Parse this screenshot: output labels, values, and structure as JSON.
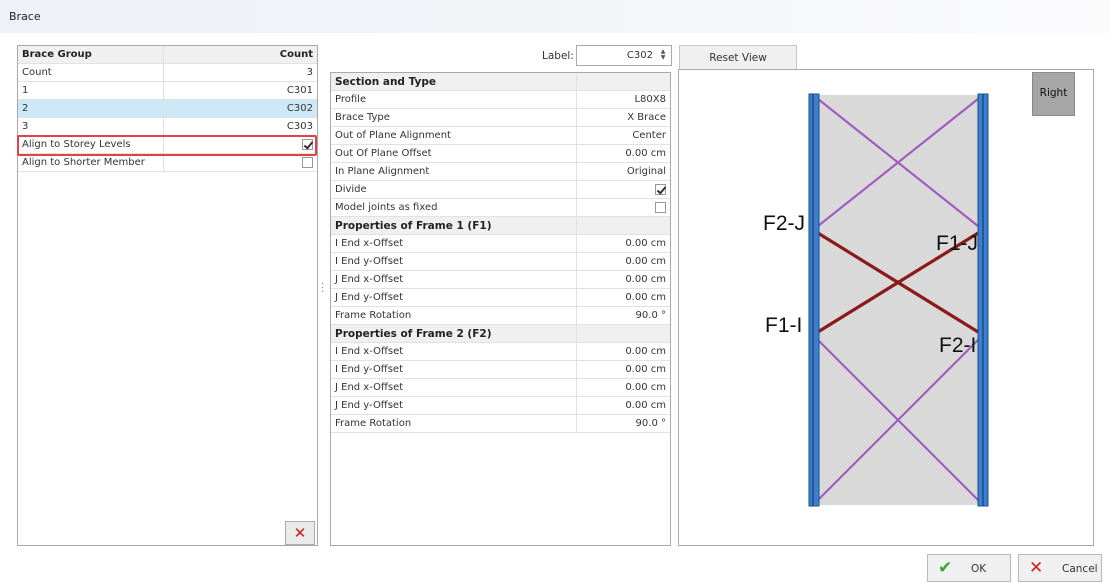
{
  "window": {
    "title": "Brace"
  },
  "brace_group": {
    "header": {
      "name": "Brace Group",
      "value": "Count"
    },
    "rows": [
      {
        "name": "Count",
        "value": "3"
      },
      {
        "name": "1",
        "value": "C301"
      },
      {
        "name": "2",
        "value": "C302",
        "selected": true
      },
      {
        "name": "3",
        "value": "C303"
      }
    ],
    "options": [
      {
        "name": "Align to Storey Levels",
        "checked": true
      },
      {
        "name": "Align to Shorter Member",
        "checked": false
      }
    ],
    "delete_icon": "x-icon"
  },
  "label_field": {
    "label": "Label:",
    "value": "C302"
  },
  "properties": {
    "section1": {
      "title": "Section and Type",
      "rows": [
        {
          "name": "Profile",
          "value": "L80X8"
        },
        {
          "name": "Brace Type",
          "value": "X Brace"
        },
        {
          "name": "Out of Plane Alignment",
          "value": "Center"
        },
        {
          "name": "Out Of Plane Offset",
          "value": "0.00 cm"
        },
        {
          "name": "In Plane Alignment",
          "value": "Original"
        }
      ],
      "checks": [
        {
          "name": "Divide",
          "checked": true
        },
        {
          "name": "Model joints as fixed",
          "checked": false
        }
      ]
    },
    "section2": {
      "title": "Properties of Frame 1 (F1)",
      "rows": [
        {
          "name": "I End x-Offset",
          "value": "0.00 cm"
        },
        {
          "name": "I End y-Offset",
          "value": "0.00 cm"
        },
        {
          "name": "J End x-Offset",
          "value": "0.00 cm"
        },
        {
          "name": "J End y-Offset",
          "value": "0.00 cm"
        },
        {
          "name": "Frame Rotation",
          "value": "90.0 °"
        }
      ]
    },
    "section3": {
      "title": "Properties of Frame 2 (F2)",
      "rows": [
        {
          "name": "I End x-Offset",
          "value": "0.00 cm"
        },
        {
          "name": "I End y-Offset",
          "value": "0.00 cm"
        },
        {
          "name": "J End x-Offset",
          "value": "0.00 cm"
        },
        {
          "name": "J End y-Offset",
          "value": "0.00 cm"
        },
        {
          "name": "Frame Rotation",
          "value": "90.0 °"
        }
      ]
    }
  },
  "viewer": {
    "reset_label": "Reset View",
    "view_label": "Right",
    "frame_labels": {
      "f2j": "F2-J",
      "f1j": "F1-J",
      "f1i": "F1-I",
      "f2i": "F2-I"
    },
    "colors": {
      "column": "#3a7fd0",
      "panel": "#d9d9d9",
      "brace_light": "#a25cbf",
      "brace_dark": "#8b1a1a"
    }
  },
  "buttons": {
    "ok": "OK",
    "cancel": "Cancel",
    "ok_icon": "check-icon",
    "cancel_icon": "x-icon"
  }
}
